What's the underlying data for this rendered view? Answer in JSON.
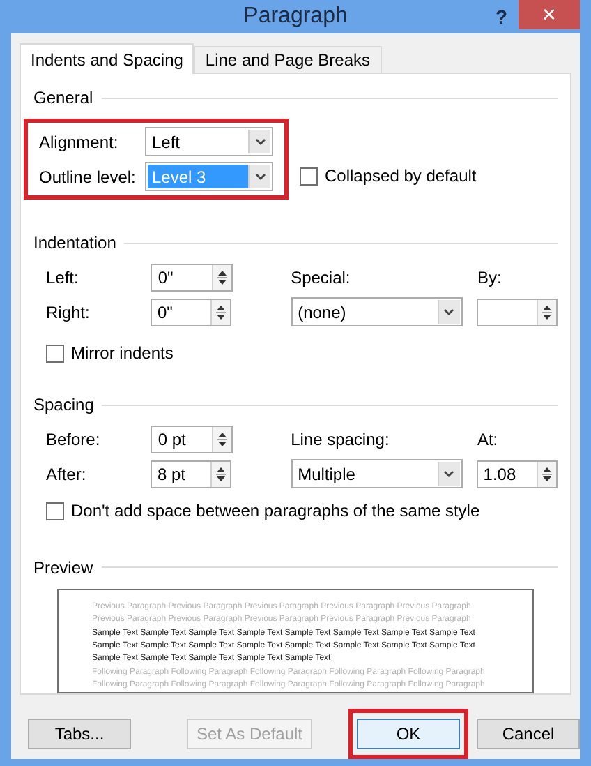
{
  "window": {
    "title": "Paragraph",
    "help_button": "?",
    "close_button": "✕"
  },
  "tabs": [
    {
      "label": "Indents and Spacing",
      "selected": true
    },
    {
      "label": "Line and Page Breaks",
      "selected": false
    }
  ],
  "general": {
    "title": "General",
    "highlighted": true,
    "alignment": {
      "label": "Alignment:",
      "value": "Left",
      "focused": false
    },
    "outline_level": {
      "label": "Outline level:",
      "value": "Level 3",
      "focused": true
    },
    "collapsed": {
      "label": "Collapsed by default",
      "checked": false
    }
  },
  "indentation": {
    "title": "Indentation",
    "left": {
      "label": "Left:",
      "value": "0\""
    },
    "right": {
      "label": "Right:",
      "value": "0\""
    },
    "special": {
      "label": "Special:",
      "value": "(none)"
    },
    "by": {
      "label": "By:"
    },
    "mirror": {
      "label": "Mirror indents",
      "checked": false
    }
  },
  "spacing": {
    "title": "Spacing",
    "before": {
      "label": "Before:",
      "value": "0 pt"
    },
    "after": {
      "label": "After:",
      "value": "8 pt"
    },
    "line_spacing": {
      "label": "Line spacing:",
      "value": "Multiple"
    },
    "at": {
      "label": "At:",
      "value": "1.08"
    },
    "dont_add": {
      "label": "Don't add space between paragraphs of the same style",
      "checked": false
    }
  },
  "preview": {
    "title": "Preview",
    "previous_lines": [
      "Previous Paragraph Previous Paragraph Previous Paragraph Previous Paragraph Previous Paragraph",
      "Previous Paragraph Previous Paragraph Previous Paragraph Previous Paragraph Previous Paragraph"
    ],
    "sample_lines": [
      "Sample Text Sample Text Sample Text Sample Text Sample Text Sample Text Sample Text Sample Text",
      "Sample Text Sample Text Sample Text Sample Text Sample Text Sample Text Sample Text Sample Text",
      "Sample Text Sample Text Sample Text Sample Text Sample Text"
    ],
    "following_lines": [
      "Following Paragraph Following Paragraph Following Paragraph Following Paragraph Following Paragraph",
      "Following Paragraph Following Paragraph Following Paragraph Following Paragraph Following Paragraph"
    ]
  },
  "buttons": [
    {
      "label": "Tabs...",
      "disabled": false,
      "default": false,
      "highlighted": false
    },
    {
      "label": "Set As Default",
      "disabled": true,
      "default": false,
      "highlighted": false
    },
    {
      "label": "OK",
      "disabled": false,
      "default": true,
      "highlighted": true
    },
    {
      "label": "Cancel",
      "disabled": false,
      "default": false,
      "highlighted": false
    }
  ]
}
